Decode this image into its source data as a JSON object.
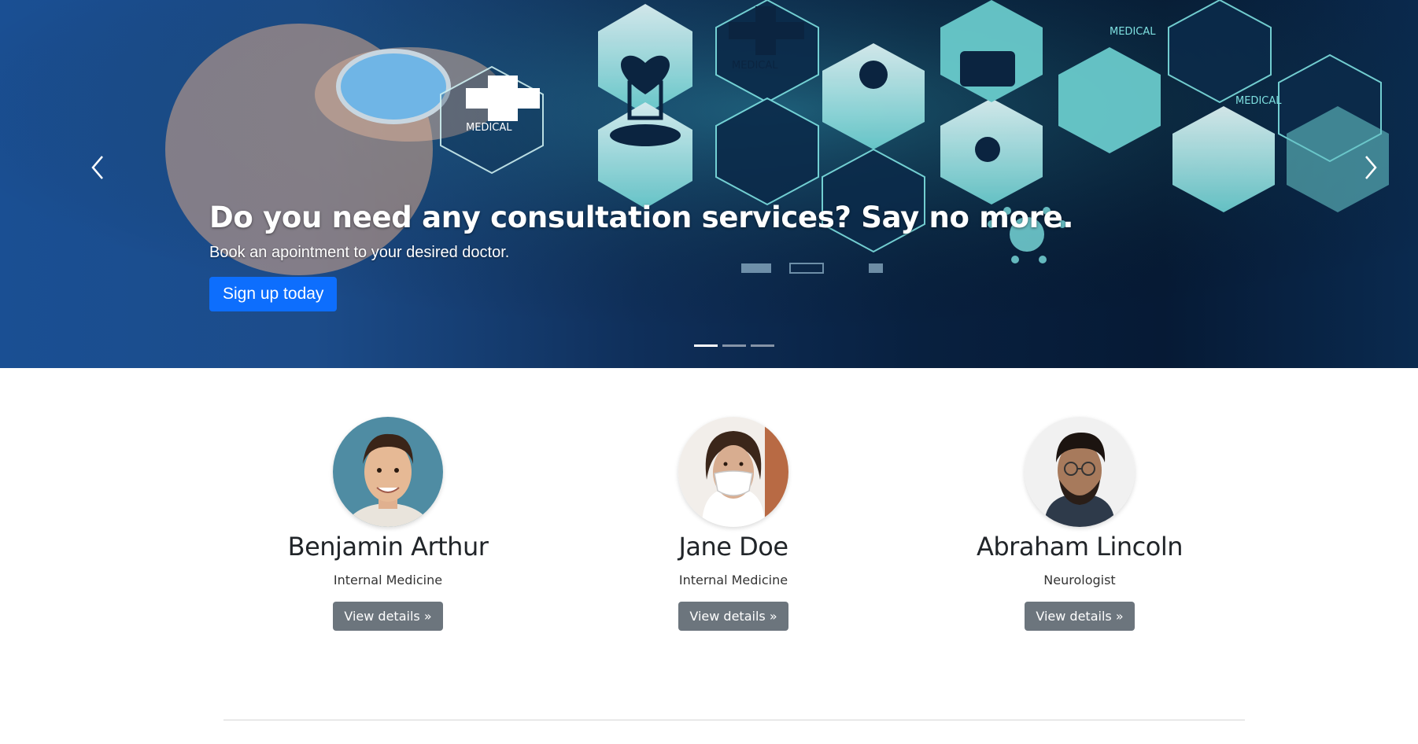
{
  "hero": {
    "title": "Do you need any consultation services? Say no more.",
    "subtitle": "Book an apointment to your desired doctor.",
    "cta_label": "Sign up today",
    "bg_labels": [
      "MEDICAL",
      "MEDICAL",
      "MEDICAL",
      "MEDICAL"
    ],
    "indicator_count": 3,
    "active_indicator": 0
  },
  "doctors": [
    {
      "name": "Benjamin Arthur",
      "specialty": "Internal Medicine",
      "button_label": "View details »"
    },
    {
      "name": "Jane Doe",
      "specialty": "Internal Medicine",
      "button_label": "View details »"
    },
    {
      "name": "Abraham Lincoln",
      "specialty": "Neurologist",
      "button_label": "View details »"
    }
  ],
  "colors": {
    "primary": "#0d6efd",
    "secondary": "#6c757d"
  }
}
